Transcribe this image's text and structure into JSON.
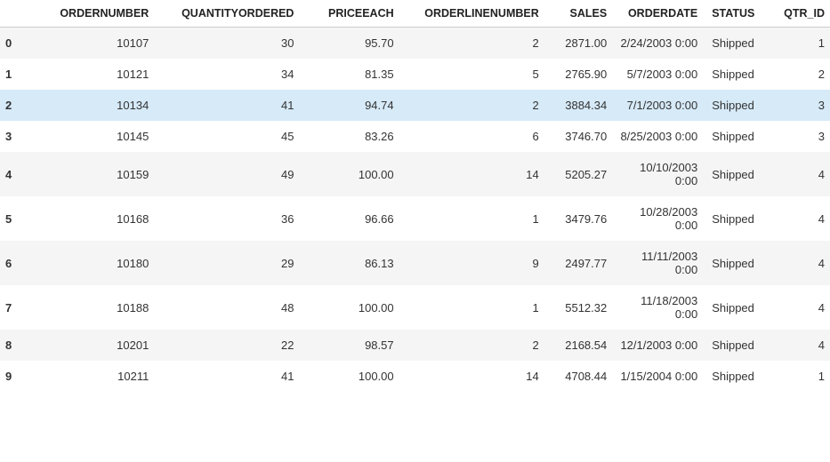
{
  "table": {
    "columns": [
      "",
      "ORDERNUMBER",
      "QUANTITYORDERED",
      "PRICEEACH",
      "ORDERLINENUMBER",
      "SALES",
      "ORDERDATE",
      "STATUS",
      "QTR_ID"
    ],
    "highlightRow": 2,
    "rows": [
      {
        "idx": "0",
        "ordernumber": "10107",
        "qty": "30",
        "price": "95.70",
        "orderline": "2",
        "sales": "2871.00",
        "orderdate": "2/24/2003 0:00",
        "status": "Shipped",
        "qtr": "1"
      },
      {
        "idx": "1",
        "ordernumber": "10121",
        "qty": "34",
        "price": "81.35",
        "orderline": "5",
        "sales": "2765.90",
        "orderdate": "5/7/2003 0:00",
        "status": "Shipped",
        "qtr": "2"
      },
      {
        "idx": "2",
        "ordernumber": "10134",
        "qty": "41",
        "price": "94.74",
        "orderline": "2",
        "sales": "3884.34",
        "orderdate": "7/1/2003 0:00",
        "status": "Shipped",
        "qtr": "3"
      },
      {
        "idx": "3",
        "ordernumber": "10145",
        "qty": "45",
        "price": "83.26",
        "orderline": "6",
        "sales": "3746.70",
        "orderdate": "8/25/2003 0:00",
        "status": "Shipped",
        "qtr": "3"
      },
      {
        "idx": "4",
        "ordernumber": "10159",
        "qty": "49",
        "price": "100.00",
        "orderline": "14",
        "sales": "5205.27",
        "orderdate": "10/10/2003 0:00",
        "status": "Shipped",
        "qtr": "4"
      },
      {
        "idx": "5",
        "ordernumber": "10168",
        "qty": "36",
        "price": "96.66",
        "orderline": "1",
        "sales": "3479.76",
        "orderdate": "10/28/2003 0:00",
        "status": "Shipped",
        "qtr": "4"
      },
      {
        "idx": "6",
        "ordernumber": "10180",
        "qty": "29",
        "price": "86.13",
        "orderline": "9",
        "sales": "2497.77",
        "orderdate": "11/11/2003 0:00",
        "status": "Shipped",
        "qtr": "4"
      },
      {
        "idx": "7",
        "ordernumber": "10188",
        "qty": "48",
        "price": "100.00",
        "orderline": "1",
        "sales": "5512.32",
        "orderdate": "11/18/2003 0:00",
        "status": "Shipped",
        "qtr": "4"
      },
      {
        "idx": "8",
        "ordernumber": "10201",
        "qty": "22",
        "price": "98.57",
        "orderline": "2",
        "sales": "2168.54",
        "orderdate": "12/1/2003 0:00",
        "status": "Shipped",
        "qtr": "4"
      },
      {
        "idx": "9",
        "ordernumber": "10211",
        "qty": "41",
        "price": "100.00",
        "orderline": "14",
        "sales": "4708.44",
        "orderdate": "1/15/2004 0:00",
        "status": "Shipped",
        "qtr": "1"
      }
    ]
  }
}
